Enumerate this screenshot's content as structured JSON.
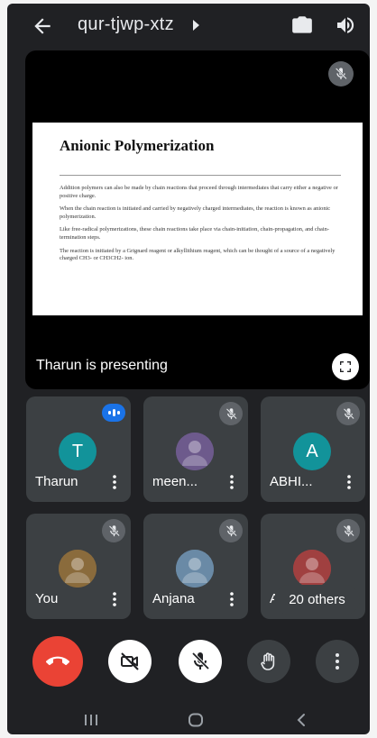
{
  "header": {
    "meeting_code": "qur-tjwp-xtz",
    "back_icon": "arrow-left-icon",
    "caret_icon": "caret-right-icon",
    "switch_camera_icon": "switch-camera-icon",
    "speaker_icon": "volume-icon"
  },
  "presentation": {
    "presenter_label": "Tharun is presenting",
    "slide": {
      "title": "Anionic Polymerization",
      "paragraphs": [
        "Addition polymers can also be made by chain reactions that proceed through intermediates that carry either a negative or positive charge.",
        "When the chain reaction is initiated and carried by negatively charged intermediates, the reaction is known as anionic polymerization.",
        "Like free-radical polymerizations, these chain reactions take place via chain-initiation, chain-propagation, and chain-termination steps.",
        "The reaction is initiated by a Grignard reagent or alkyllithium reagent, which can be thought of a source of a negatively charged CH3- or CH3CH2- ion."
      ]
    }
  },
  "participants": [
    {
      "name": "Tharun",
      "initial": "T",
      "avatar_color": "#12939a",
      "state": "speaking"
    },
    {
      "name": "meen...",
      "initial": "",
      "avatar_color": "#6d5a8c",
      "state": "muted"
    },
    {
      "name": "ABHI...",
      "initial": "A",
      "avatar_color": "#12939a",
      "state": "muted"
    },
    {
      "name": "You",
      "initial": "",
      "avatar_color": "#8a6b3c",
      "state": "muted"
    },
    {
      "name": "Anjana",
      "initial": "",
      "avatar_color": "#6a8aa6",
      "state": "muted"
    },
    {
      "name": "A",
      "initial": "",
      "avatar_color": "#a04040",
      "state": "muted"
    }
  ],
  "others_label": "20 others",
  "controls": {
    "end_call_color": "#ea4335",
    "icons": [
      "end-call-icon",
      "camera-off-icon",
      "mic-off-icon",
      "raise-hand-icon",
      "more-vert-icon"
    ]
  },
  "nav": {
    "icons": [
      "recents-icon",
      "home-icon",
      "back-icon"
    ]
  }
}
